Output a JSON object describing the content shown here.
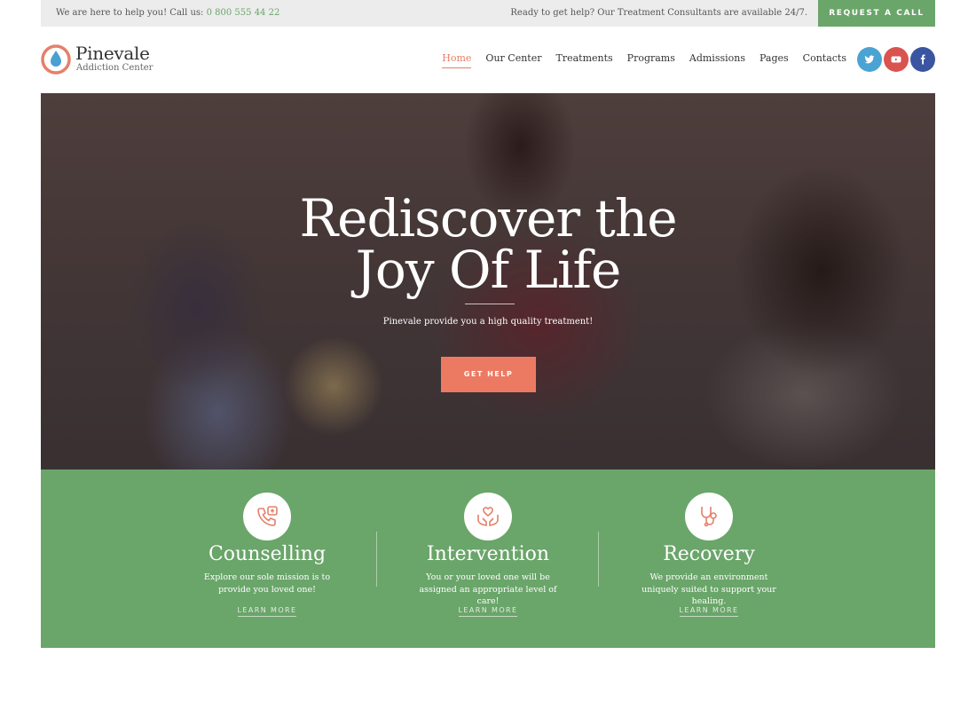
{
  "topbar": {
    "help_text": "We are here to help you! Call us:",
    "phone": "0 800 555 44 22",
    "ready_text": "Ready to get help? Our Treatment Consultants are available 24/7.",
    "request_button": "REQUEST A CALL"
  },
  "header": {
    "logo_name": "Pinevale",
    "logo_sub": "Addiction Center",
    "nav": [
      {
        "label": "Home"
      },
      {
        "label": "Our Center"
      },
      {
        "label": "Treatments"
      },
      {
        "label": "Programs"
      },
      {
        "label": "Admissions"
      },
      {
        "label": "Pages"
      },
      {
        "label": "Contacts"
      }
    ],
    "social": {
      "twitter": "t",
      "youtube": "▶",
      "facebook": "f"
    }
  },
  "hero": {
    "title_line1": "Rediscover the",
    "title_line2": "Joy Of Life",
    "subtitle": "Pinevale provide you a high quality treatment!",
    "button": "GET HELP"
  },
  "features": [
    {
      "icon": "phone-plus-icon",
      "title": "Counselling",
      "text": "Explore our sole mission is to provide you loved one!",
      "link": "LEARN MORE"
    },
    {
      "icon": "hands-heart-icon",
      "title": "Intervention",
      "text": "You or your loved one will be assigned an appropriate level of care!",
      "link": "LEARN MORE"
    },
    {
      "icon": "stethoscope-icon",
      "title": "Recovery",
      "text": "We provide an environment uniquely suited to support your healing.",
      "link": "LEARN MORE"
    }
  ],
  "colors": {
    "accent": "#ec7a63",
    "green": "#6aa56a",
    "twitter": "#4ba3d3",
    "youtube": "#d9534f",
    "facebook": "#3b55a0"
  }
}
